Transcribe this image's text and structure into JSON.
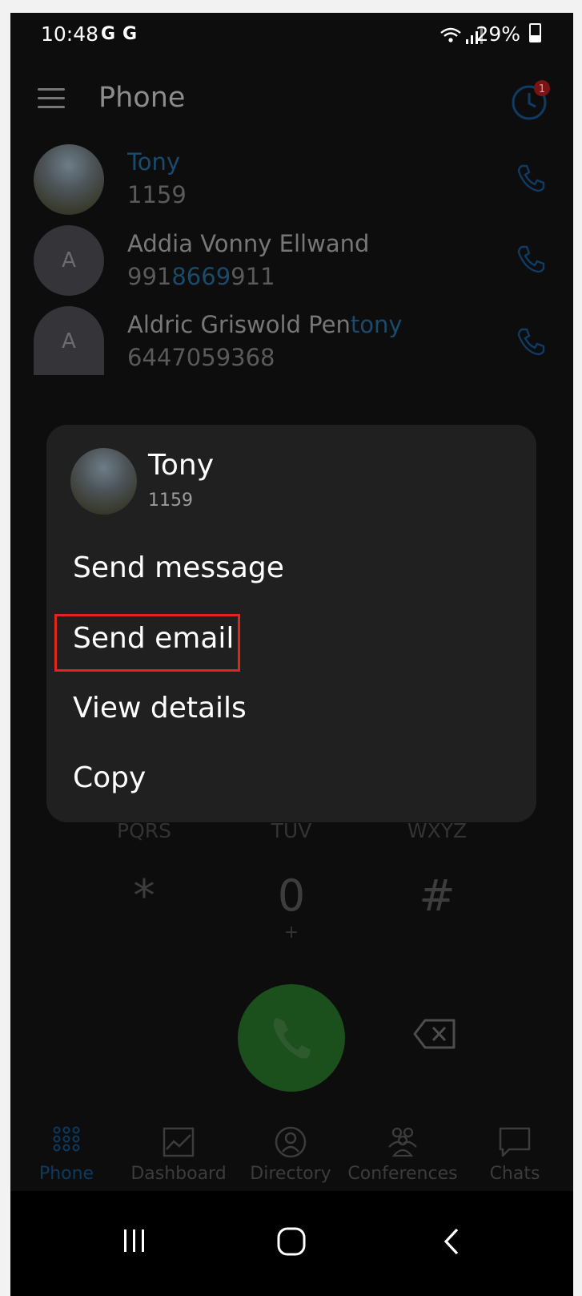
{
  "status_bar": {
    "time": "10:48",
    "notif_icons": [
      "G",
      "G"
    ],
    "battery": "29%"
  },
  "header": {
    "title": "Phone",
    "history_badge": "1"
  },
  "results": [
    {
      "name_parts": [
        {
          "text": "Tony",
          "hl": true
        }
      ],
      "number_parts": [
        {
          "text": "1159",
          "hl": false
        }
      ],
      "avatar": "photo"
    },
    {
      "name_parts": [
        {
          "text": "Addia Vonny Ellwand",
          "hl": false
        }
      ],
      "number_parts": [
        {
          "text": "991",
          "hl": false
        },
        {
          "text": "8669",
          "hl": true
        },
        {
          "text": "911",
          "hl": false
        }
      ],
      "avatar": "A"
    },
    {
      "name_parts": [
        {
          "text": "Aldric Griswold Pen",
          "hl": false
        },
        {
          "text": "tony",
          "hl": true
        }
      ],
      "number_parts": [
        {
          "text": "6447059368",
          "hl": false
        }
      ],
      "avatar": "A"
    }
  ],
  "dialer": {
    "letters_row": [
      "PQRS",
      "TUV",
      "WXYZ"
    ],
    "keys": [
      {
        "main": "*",
        "sub": ""
      },
      {
        "main": "0",
        "sub": "+"
      },
      {
        "main": "#",
        "sub": ""
      }
    ]
  },
  "context_menu": {
    "contact_name": "Tony",
    "contact_number": "1159",
    "items": [
      "Send message",
      "Send email",
      "View details",
      "Copy"
    ],
    "highlighted_item": "Send email"
  },
  "bottom_nav": [
    {
      "label": "Phone",
      "icon": "dialpad-icon",
      "active": true
    },
    {
      "label": "Dashboard",
      "icon": "dashboard-icon",
      "active": false
    },
    {
      "label": "Directory",
      "icon": "directory-icon",
      "active": false
    },
    {
      "label": "Conferences",
      "icon": "conferences-icon",
      "active": false
    },
    {
      "label": "Chats",
      "icon": "chats-icon",
      "active": false
    }
  ],
  "colors": {
    "accent": "#1a4a6c",
    "call_green": "#1b501d",
    "highlight_box": "#e0261a",
    "badge_red": "#c62828"
  }
}
